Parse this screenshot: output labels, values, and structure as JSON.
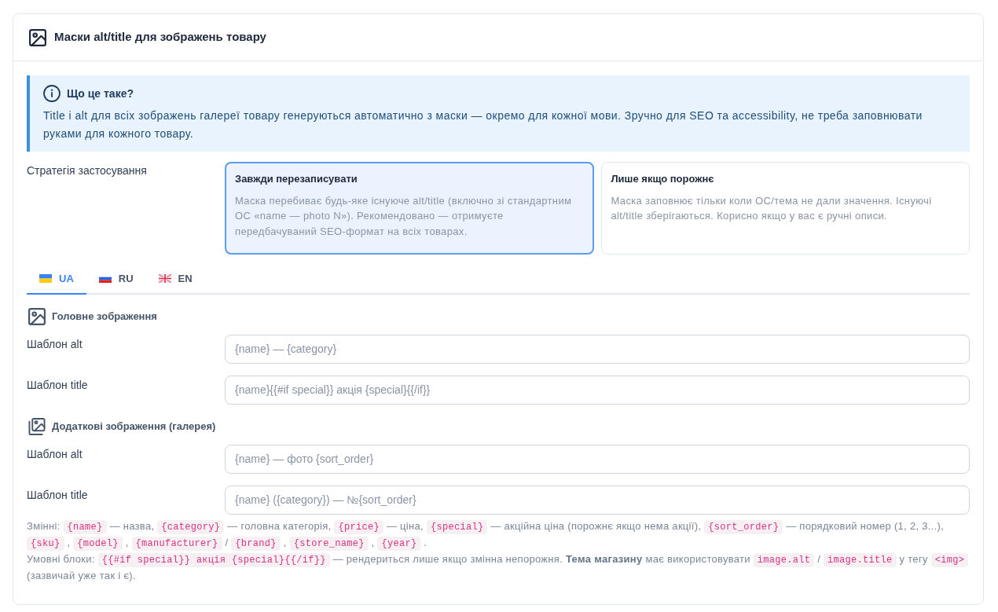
{
  "card": {
    "title": "Маски alt/title для зображень товару"
  },
  "info": {
    "title": "Що це таке?",
    "text": "Title і alt для всіх зображень галереї товару генеруються автоматично з маски — окремо для кожної мови. Зручно для SEO та accessibility, не треба заповнювати руками для кожного товару."
  },
  "strategy": {
    "label": "Стратегія застосування",
    "options": [
      {
        "title": "Завжди перезаписувати",
        "description": "Маска перебиває будь-яке існуюче alt/title (включно зі стандартним ОС «name — photo N»). Рекомендовано — отримуєте передбачуваний SEO-формат на всіх товарах.",
        "selected": true
      },
      {
        "title": "Лише якщо порожнє",
        "description": "Маска заповнює тільки коли ОС/тема не дали значення. Існуючі alt/title зберігаються. Корисно якщо у вас є ручні описи.",
        "selected": false
      }
    ]
  },
  "tabs": [
    {
      "label": "UA",
      "kind": "ua",
      "selected": true
    },
    {
      "label": "RU",
      "kind": "ru",
      "selected": false
    },
    {
      "label": "EN",
      "kind": "en",
      "selected": false
    }
  ],
  "sections": [
    {
      "title": "Головне зображення",
      "kind": "single",
      "fields": [
        {
          "label": "Шаблон alt",
          "placeholder": "{name} — {category}"
        },
        {
          "label": "Шаблон title",
          "placeholder": "{name}{{#if special}} акція {special}{{/if}}"
        }
      ]
    },
    {
      "title": "Додаткові зображення (галерея)",
      "kind": "gallery",
      "fields": [
        {
          "label": "Шаблон alt",
          "placeholder": "{name} — фото {sort_order}"
        },
        {
          "label": "Шаблон title",
          "placeholder": "{name} ({category}) — №{sort_order}"
        }
      ]
    }
  ],
  "help": [
    {
      "segments": [
        {
          "kind": "text",
          "text": "Змінні:"
        },
        {
          "kind": "code",
          "text": "{name}"
        },
        {
          "kind": "text",
          "text": "— назва,"
        },
        {
          "kind": "code",
          "text": "{category}"
        },
        {
          "kind": "text",
          "text": "— головна категорія,"
        },
        {
          "kind": "code",
          "text": "{price}"
        },
        {
          "kind": "text",
          "text": "— ціна,"
        },
        {
          "kind": "code",
          "text": "{special}"
        },
        {
          "kind": "text",
          "text": "— акційна ціна (порожнє якщо нема акції),"
        },
        {
          "kind": "code",
          "text": "{sort_order}"
        },
        {
          "kind": "text",
          "text": "— порядковий номер (1, 2, 3...),"
        },
        {
          "kind": "code",
          "text": "{sku}"
        },
        {
          "kind": "text",
          "text": ","
        },
        {
          "kind": "code",
          "text": "{model}"
        },
        {
          "kind": "text",
          "text": ","
        },
        {
          "kind": "code",
          "text": "{manufacturer}"
        },
        {
          "kind": "text",
          "text": "/"
        },
        {
          "kind": "code",
          "text": "{brand}"
        },
        {
          "kind": "text",
          "text": ","
        },
        {
          "kind": "code",
          "text": "{store_name}"
        },
        {
          "kind": "text",
          "text": ","
        },
        {
          "kind": "code",
          "text": "{year}"
        },
        {
          "kind": "text",
          "text": "."
        }
      ]
    },
    {
      "segments": [
        {
          "kind": "text",
          "text": "Умовні блоки:"
        },
        {
          "kind": "code",
          "text": "{{#if special}} акція {special}{{/if}}"
        },
        {
          "kind": "text",
          "text": "— рендериться лише якщо змінна непорожня. **Тема магазину** має використовувати"
        },
        {
          "kind": "code",
          "text": "image.alt"
        },
        {
          "kind": "text",
          "text": "/"
        },
        {
          "kind": "code",
          "text": "image.title"
        },
        {
          "kind": "text",
          "text": "у тегу"
        },
        {
          "kind": "code",
          "text": "<img>"
        },
        {
          "kind": "text",
          "text": "(зазвичай уже так і є)."
        }
      ]
    }
  ]
}
